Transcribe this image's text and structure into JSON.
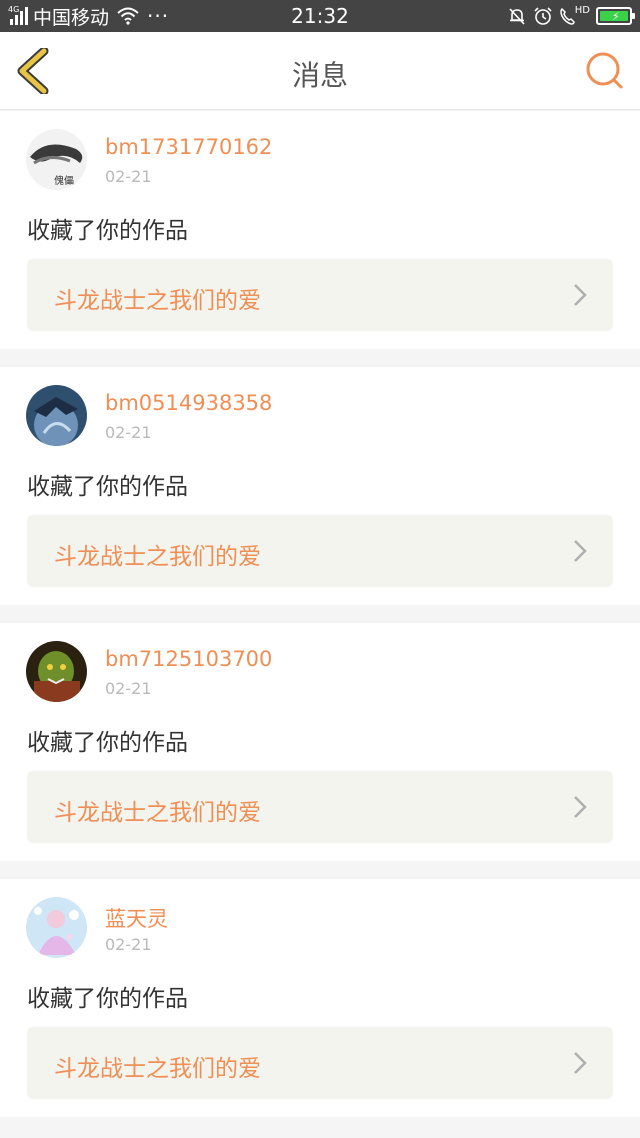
{
  "status_bar": {
    "network": "4G",
    "carrier": "中国移动",
    "more": "···",
    "time": "21:32",
    "hd": "HD"
  },
  "header": {
    "title": "消息"
  },
  "colors": {
    "accent": "#ef8f55",
    "back_icon": "#e8c545",
    "card_bg": "#f4f4ee"
  },
  "messages": [
    {
      "username": "bm1731770162",
      "date": "02-21",
      "action": "收藏了你的作品",
      "work_title": "斗龙战士之我们的爱",
      "avatar_text": "傀儡"
    },
    {
      "username": "bm0514938358",
      "date": "02-21",
      "action": "收藏了你的作品",
      "work_title": "斗龙战士之我们的爱"
    },
    {
      "username": "bm7125103700",
      "date": "02-21",
      "action": "收藏了你的作品",
      "work_title": "斗龙战士之我们的爱"
    },
    {
      "username": "蓝天灵",
      "date": "02-21",
      "action": "收藏了你的作品",
      "work_title": "斗龙战士之我们的爱"
    }
  ]
}
